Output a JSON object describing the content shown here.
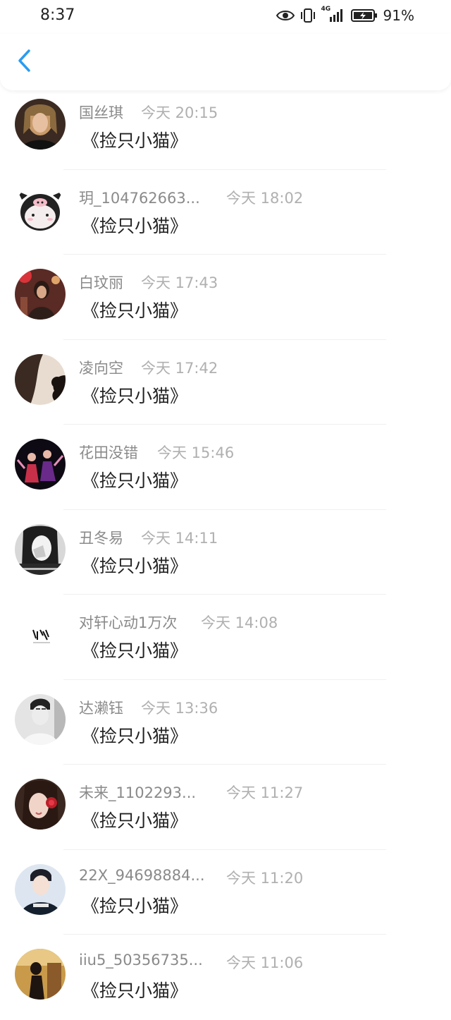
{
  "status_bar": {
    "time": "8:37",
    "network": "4G",
    "battery": "91%"
  },
  "nav": {
    "back_icon": "chevron-left-icon",
    "accent_color": "#2b9bf0"
  },
  "comments": [
    {
      "name": "国丝琪",
      "time": "今天 20:15",
      "text": "《捡只小猫》",
      "avatar": "portrait-blonde"
    },
    {
      "name": "玥_104762663...",
      "time": "今天 18:02",
      "text": "《捡只小猫》",
      "avatar": "pig-cartoon"
    },
    {
      "name": "白玟丽",
      "time": "今天 17:43",
      "text": "《捡只小猫》",
      "avatar": "portrait-red"
    },
    {
      "name": "凌向空",
      "time": "今天 17:42",
      "text": "《捡只小猫》",
      "avatar": "silhouette-dark"
    },
    {
      "name": "花田没错",
      "time": "今天 15:46",
      "text": "《捡只小猫》",
      "avatar": "group-dark"
    },
    {
      "name": "丑冬易",
      "time": "今天 14:11",
      "text": "《捡只小猫》",
      "avatar": "girl-bw"
    },
    {
      "name": "对轩心动1万次",
      "time": "今天 14:08",
      "text": "《捡只小猫》",
      "avatar": "calligraphy"
    },
    {
      "name": "达濑钰",
      "time": "今天 13:36",
      "text": "《捡只小猫》",
      "avatar": "boy-bw"
    },
    {
      "name": "未来_1102293...",
      "time": "今天 11:27",
      "text": "《捡只小猫》",
      "avatar": "girl-rose"
    },
    {
      "name": "22X_94698884...",
      "time": "今天 11:20",
      "text": "《捡只小猫》",
      "avatar": "boy-tee"
    },
    {
      "name": "iiu5_50356735...",
      "time": "今天 11:06",
      "text": "《捡只小猫》",
      "avatar": "girl-gold"
    }
  ]
}
